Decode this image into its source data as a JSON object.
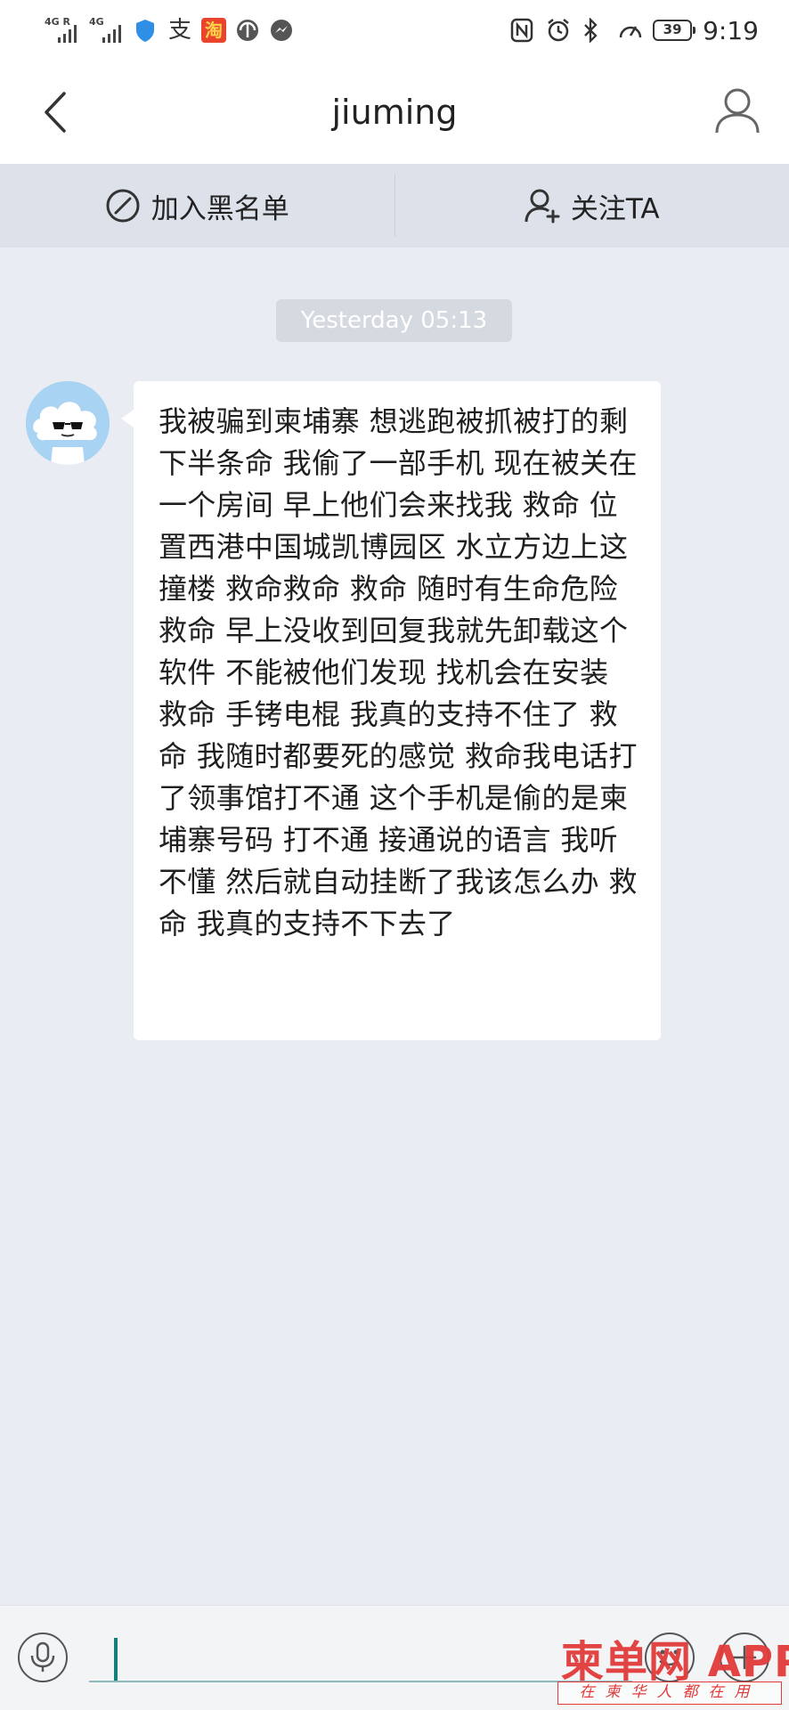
{
  "status_bar": {
    "signal1_label": "4G R",
    "signal2_label": "4G",
    "alipay_glyph": "支",
    "taobao_glyph": "淘",
    "battery": "39",
    "time": "9:19",
    "icons": [
      "signal-icon",
      "shield-icon",
      "alipay-icon",
      "taobao-icon",
      "app-icon",
      "messenger-icon",
      "nfc-icon",
      "alarm-icon",
      "bluetooth-icon",
      "speed-icon",
      "battery-icon"
    ]
  },
  "header": {
    "title": "jiuming",
    "back_icon": "chevron-left-icon",
    "profile_icon": "person-icon"
  },
  "actions": {
    "blacklist_label": "加入黑名单",
    "follow_label": "关注TA"
  },
  "chat": {
    "timestamp": "Yesterday 05:13",
    "message": "我被骗到柬埔寨 想逃跑被抓被打的剩下半条命 我偷了一部手机 现在被关在一个房间 早上他们会来找我 救命 位置西港中国城凯博园区 水立方边上这撞楼 救命救命 救命 随时有生命危险 救命 早上没收到回复我就先卸载这个软件 不能被他们发现 找机会在安装 救命 手铐电棍 我真的支持不住了 救命 我随时都要死的感觉 救命我电话打了领事馆打不通 这个手机是偷的是柬埔寨号码 打不通 接通说的语言 我听不懂 然后就自动挂断了我该怎么办 救命 我真的支持不下去了"
  },
  "input_bar": {
    "value": "",
    "icons": [
      "microphone-icon",
      "emoji-icon",
      "plus-icon"
    ]
  },
  "watermark": {
    "main": "柬单网 APP",
    "sub": "在柬华人都在用"
  },
  "colors": {
    "background": "#e9ecf2",
    "action_bar": "#dde2ea",
    "caret": "#15807a",
    "watermark": "#e23a3a"
  }
}
